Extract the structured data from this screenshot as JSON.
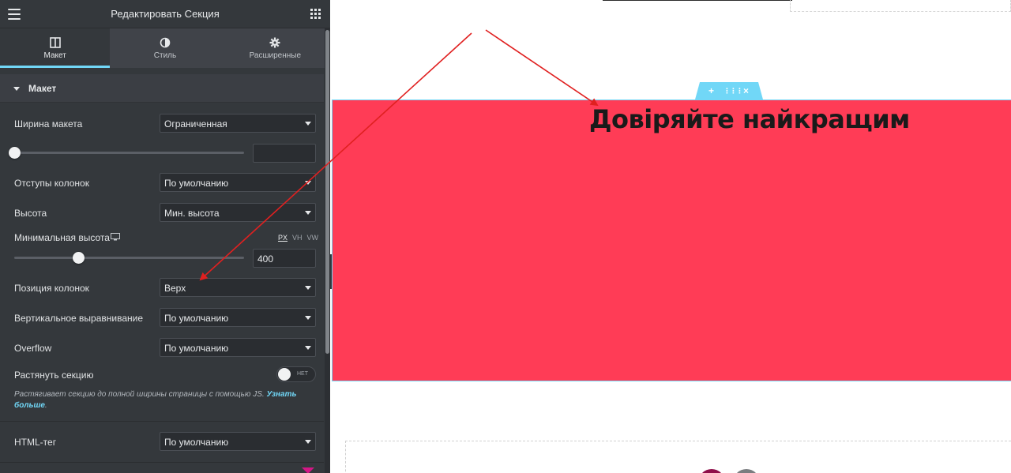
{
  "header": {
    "title": "Редактировать Секция"
  },
  "tabs": [
    {
      "label": "Макет",
      "icon": "columns-icon",
      "active": true
    },
    {
      "label": "Стиль",
      "icon": "half-circle-icon",
      "active": false
    },
    {
      "label": "Расширенные",
      "icon": "gear-icon",
      "active": false
    }
  ],
  "section": {
    "title": "Макет"
  },
  "controls": {
    "layout_width": {
      "label": "Ширина макета",
      "value": "Ограниченная"
    },
    "column_gap": {
      "label": "Отступы колонок",
      "value": "По умолчанию"
    },
    "height": {
      "label": "Высота",
      "value": "Мин. высота"
    },
    "min_height": {
      "label": "Минимальная высота",
      "value": "400",
      "units": [
        "PX",
        "VH",
        "VW"
      ],
      "active_unit": "PX",
      "slider_fraction": 0.28
    },
    "column_position": {
      "label": "Позиция колонок",
      "value": "Верх"
    },
    "vertical_align": {
      "label": "Вертикальное выравнивание",
      "value": "По умолчанию"
    },
    "overflow": {
      "label": "Overflow",
      "value": "По умолчанию"
    },
    "stretch": {
      "label": "Растянуть секцию",
      "toggle_text": "НЕТ",
      "help": "Растягивает секцию до полной ширины страницы с помощью JS. ",
      "help_link": "Узнать больше"
    },
    "html_tag": {
      "label": "HTML-тег",
      "value": "По умолчанию"
    }
  },
  "canvas": {
    "heading": "Довіряйте найкращим",
    "toolbar": {
      "add": "+",
      "move": "⋮⋮⋮",
      "close": "×"
    }
  },
  "colors": {
    "accent": "#71d7f7",
    "section_bg": "#ff3c56",
    "panel_bg": "#34383c",
    "arrow": "#e02020"
  }
}
